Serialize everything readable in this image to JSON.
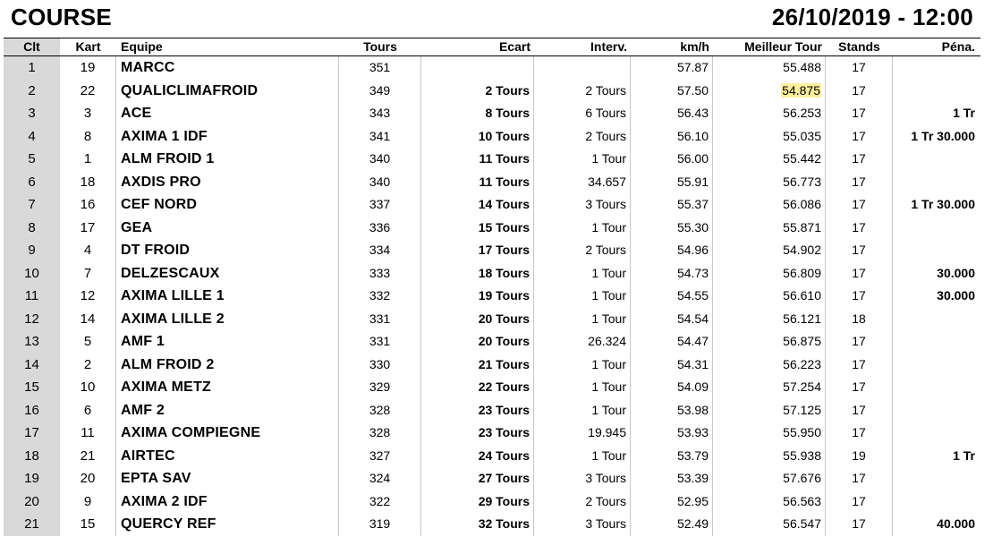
{
  "header": {
    "title": "COURSE",
    "datetime": "26/10/2019 - 12:00"
  },
  "columns": [
    "Clt",
    "Kart",
    "Equipe",
    "Tours",
    "Ecart",
    "Interv.",
    "km/h",
    "Meilleur Tour",
    "Stands",
    "Péna."
  ],
  "highlight_color": "#ffef9a",
  "rows": [
    {
      "clt": "1",
      "kart": "19",
      "equipe": "MARCC",
      "tours": "351",
      "ecart": "",
      "interv": "",
      "kmh": "57.87",
      "best": "55.488",
      "stands": "17",
      "pena": "",
      "best_highlight": false
    },
    {
      "clt": "2",
      "kart": "22",
      "equipe": "QUALICLIMAFROID",
      "tours": "349",
      "ecart": "2 Tours",
      "interv": "2 Tours",
      "kmh": "57.50",
      "best": "54.875",
      "stands": "17",
      "pena": "",
      "best_highlight": true
    },
    {
      "clt": "3",
      "kart": "3",
      "equipe": "ACE",
      "tours": "343",
      "ecart": "8 Tours",
      "interv": "6 Tours",
      "kmh": "56.43",
      "best": "56.253",
      "stands": "17",
      "pena": "1 Tr",
      "best_highlight": false
    },
    {
      "clt": "4",
      "kart": "8",
      "equipe": "AXIMA 1 IDF",
      "tours": "341",
      "ecart": "10 Tours",
      "interv": "2 Tours",
      "kmh": "56.10",
      "best": "55.035",
      "stands": "17",
      "pena": "1 Tr 30.000",
      "best_highlight": false
    },
    {
      "clt": "5",
      "kart": "1",
      "equipe": "ALM FROID 1",
      "tours": "340",
      "ecart": "11 Tours",
      "interv": "1 Tour",
      "kmh": "56.00",
      "best": "55.442",
      "stands": "17",
      "pena": "",
      "best_highlight": false
    },
    {
      "clt": "6",
      "kart": "18",
      "equipe": "AXDIS PRO",
      "tours": "340",
      "ecart": "11 Tours",
      "interv": "34.657",
      "kmh": "55.91",
      "best": "56.773",
      "stands": "17",
      "pena": "",
      "best_highlight": false
    },
    {
      "clt": "7",
      "kart": "16",
      "equipe": "CEF NORD",
      "tours": "337",
      "ecart": "14 Tours",
      "interv": "3 Tours",
      "kmh": "55.37",
      "best": "56.086",
      "stands": "17",
      "pena": "1 Tr 30.000",
      "best_highlight": false
    },
    {
      "clt": "8",
      "kart": "17",
      "equipe": "GEA",
      "tours": "336",
      "ecart": "15 Tours",
      "interv": "1 Tour",
      "kmh": "55.30",
      "best": "55.871",
      "stands": "17",
      "pena": "",
      "best_highlight": false
    },
    {
      "clt": "9",
      "kart": "4",
      "equipe": "DT FROID",
      "tours": "334",
      "ecart": "17 Tours",
      "interv": "2 Tours",
      "kmh": "54.96",
      "best": "54.902",
      "stands": "17",
      "pena": "",
      "best_highlight": false
    },
    {
      "clt": "10",
      "kart": "7",
      "equipe": "DELZESCAUX",
      "tours": "333",
      "ecart": "18 Tours",
      "interv": "1 Tour",
      "kmh": "54.73",
      "best": "56.809",
      "stands": "17",
      "pena": "30.000",
      "best_highlight": false
    },
    {
      "clt": "11",
      "kart": "12",
      "equipe": "AXIMA LILLE 1",
      "tours": "332",
      "ecart": "19 Tours",
      "interv": "1 Tour",
      "kmh": "54.55",
      "best": "56.610",
      "stands": "17",
      "pena": "30.000",
      "best_highlight": false
    },
    {
      "clt": "12",
      "kart": "14",
      "equipe": "AXIMA LILLE 2",
      "tours": "331",
      "ecart": "20 Tours",
      "interv": "1 Tour",
      "kmh": "54.54",
      "best": "56.121",
      "stands": "18",
      "pena": "",
      "best_highlight": false
    },
    {
      "clt": "13",
      "kart": "5",
      "equipe": "AMF 1",
      "tours": "331",
      "ecart": "20 Tours",
      "interv": "26.324",
      "kmh": "54.47",
      "best": "56.875",
      "stands": "17",
      "pena": "",
      "best_highlight": false
    },
    {
      "clt": "14",
      "kart": "2",
      "equipe": "ALM FROID 2",
      "tours": "330",
      "ecart": "21 Tours",
      "interv": "1 Tour",
      "kmh": "54.31",
      "best": "56.223",
      "stands": "17",
      "pena": "",
      "best_highlight": false
    },
    {
      "clt": "15",
      "kart": "10",
      "equipe": "AXIMA METZ",
      "tours": "329",
      "ecart": "22 Tours",
      "interv": "1 Tour",
      "kmh": "54.09",
      "best": "57.254",
      "stands": "17",
      "pena": "",
      "best_highlight": false
    },
    {
      "clt": "16",
      "kart": "6",
      "equipe": "AMF 2",
      "tours": "328",
      "ecart": "23 Tours",
      "interv": "1 Tour",
      "kmh": "53.98",
      "best": "57.125",
      "stands": "17",
      "pena": "",
      "best_highlight": false
    },
    {
      "clt": "17",
      "kart": "11",
      "equipe": "AXIMA COMPIEGNE",
      "tours": "328",
      "ecart": "23 Tours",
      "interv": "19.945",
      "kmh": "53.93",
      "best": "55.950",
      "stands": "17",
      "pena": "",
      "best_highlight": false
    },
    {
      "clt": "18",
      "kart": "21",
      "equipe": "AIRTEC",
      "tours": "327",
      "ecart": "24 Tours",
      "interv": "1 Tour",
      "kmh": "53.79",
      "best": "55.938",
      "stands": "19",
      "pena": "1 Tr",
      "best_highlight": false
    },
    {
      "clt": "19",
      "kart": "20",
      "equipe": "EPTA SAV",
      "tours": "324",
      "ecart": "27 Tours",
      "interv": "3 Tours",
      "kmh": "53.39",
      "best": "57.676",
      "stands": "17",
      "pena": "",
      "best_highlight": false
    },
    {
      "clt": "20",
      "kart": "9",
      "equipe": "AXIMA 2 IDF",
      "tours": "322",
      "ecart": "29 Tours",
      "interv": "2 Tours",
      "kmh": "52.95",
      "best": "56.563",
      "stands": "17",
      "pena": "",
      "best_highlight": false
    },
    {
      "clt": "21",
      "kart": "15",
      "equipe": "QUERCY REF",
      "tours": "319",
      "ecart": "32 Tours",
      "interv": "3 Tours",
      "kmh": "52.49",
      "best": "56.547",
      "stands": "17",
      "pena": "40.000",
      "best_highlight": false
    }
  ]
}
